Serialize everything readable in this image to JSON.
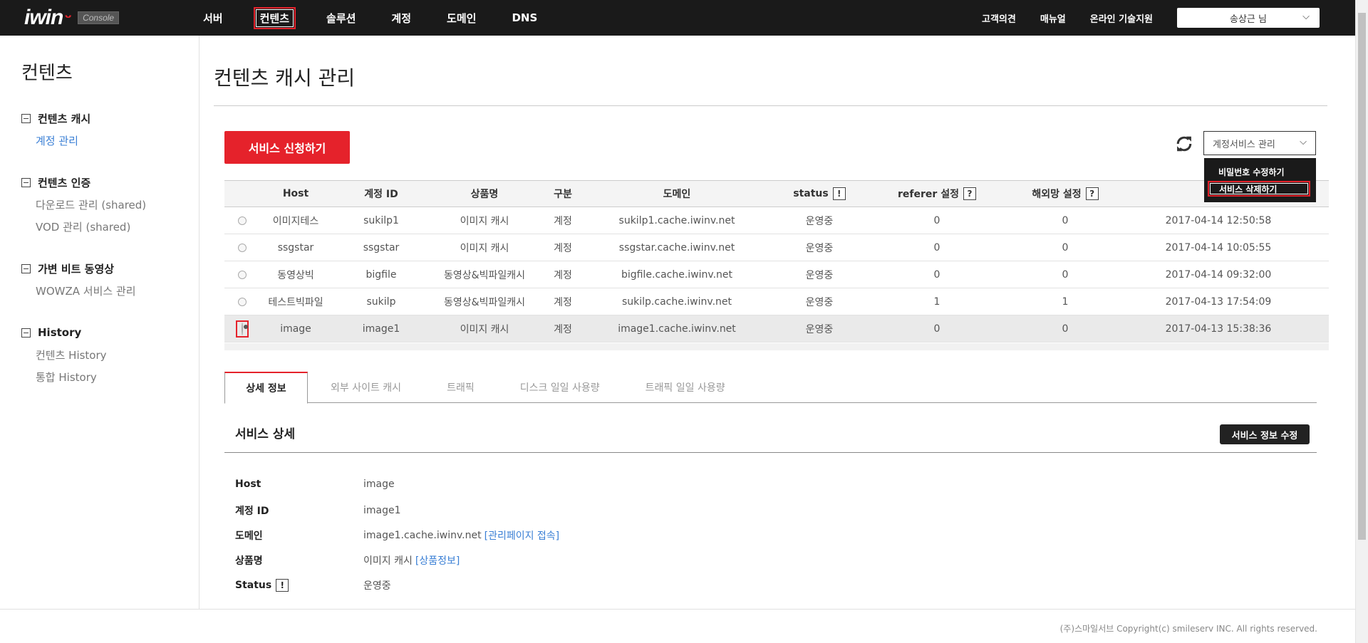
{
  "header": {
    "logo": "iwin",
    "logo_badge": "Console",
    "nav": [
      "서버",
      "컨텐츠",
      "솔루션",
      "계정",
      "도메인",
      "DNS"
    ],
    "active_nav": "컨텐츠",
    "links": [
      "고객의견",
      "매뉴얼",
      "온라인 기술지원"
    ],
    "user": "송상근 님"
  },
  "sidebar": {
    "title": "컨텐츠",
    "groups": [
      {
        "label": "컨텐츠 캐시",
        "items": [
          "계정 관리"
        ]
      },
      {
        "label": "컨텐츠 인증",
        "items": [
          "다운로드 관리 (shared)",
          "VOD 관리 (shared)"
        ]
      },
      {
        "label": "가변 비트 동영상",
        "items": [
          "WOWZA 서비스 관리"
        ]
      },
      {
        "label": "History",
        "items": [
          "컨텐츠 History",
          "통합 History"
        ]
      }
    ],
    "active_item": "계정 관리"
  },
  "main": {
    "title": "컨텐츠 캐시 관리",
    "apply_button": "서비스 신청하기",
    "account_select": "계정서비스 관리",
    "dropdown": [
      "비밀번호 수정하기",
      "서비스 삭제하기"
    ],
    "dropdown_highlight": "서비스 삭제하기"
  },
  "table": {
    "headers": [
      "Host",
      "계정 ID",
      "상품명",
      "구분",
      "도메인",
      "status",
      "referer 설정",
      "해외망 설정"
    ],
    "help_icon": "!",
    "question_icon": "?",
    "rows": [
      {
        "host": "이미지테스",
        "id": "sukilp1",
        "product": "이미지 캐시",
        "type": "계정",
        "domain": "sukilp1.cache.iwinv.net",
        "status": "운영중",
        "referer": "0",
        "overseas": "0",
        "date": "2017-04-14 12:50:58"
      },
      {
        "host": "ssgstar",
        "id": "ssgstar",
        "product": "이미지 캐시",
        "type": "계정",
        "domain": "ssgstar.cache.iwinv.net",
        "status": "운영중",
        "referer": "0",
        "overseas": "0",
        "date": "2017-04-14 10:05:55"
      },
      {
        "host": "동영상빅",
        "id": "bigfile",
        "product": "동영상&빅파일캐시",
        "type": "계정",
        "domain": "bigfile.cache.iwinv.net",
        "status": "운영중",
        "referer": "0",
        "overseas": "0",
        "date": "2017-04-14 09:32:00"
      },
      {
        "host": "테스트빅파일",
        "id": "sukilp",
        "product": "동영상&빅파일캐시",
        "type": "계정",
        "domain": "sukilp.cache.iwinv.net",
        "status": "운영중",
        "referer": "1",
        "overseas": "1",
        "date": "2017-04-13 17:54:09"
      },
      {
        "host": "image",
        "id": "image1",
        "product": "이미지 캐시",
        "type": "계정",
        "domain": "image1.cache.iwinv.net",
        "status": "운영중",
        "referer": "0",
        "overseas": "0",
        "date": "2017-04-13 15:38:36"
      }
    ],
    "selected_index": 4
  },
  "tabs": [
    "상세 정보",
    "외부 사이트 캐시",
    "트래픽",
    "디스크 일일 사용량",
    "트래픽 일일 사용량"
  ],
  "active_tab": "상세 정보",
  "detail": {
    "title": "서비스 상세",
    "edit_button": "서비스 정보 수정",
    "rows": [
      {
        "label": "Host",
        "value": "image"
      },
      {
        "label": "계정 ID",
        "value": "image1"
      },
      {
        "label": "도메인",
        "value": "image1.cache.iwinv.net",
        "link": "[관리페이지 접속]"
      },
      {
        "label": "상품명",
        "value": "이미지 캐시",
        "link": "[상품정보]"
      },
      {
        "label": "Status",
        "value": "운영중"
      }
    ]
  },
  "footer": "(주)스마일서브 Copyright(c) smileserv INC. All rights reserved.",
  "colors": {
    "accent": "#e5222b",
    "link": "#3a7fd5",
    "header_bg": "#1a1a1a"
  }
}
